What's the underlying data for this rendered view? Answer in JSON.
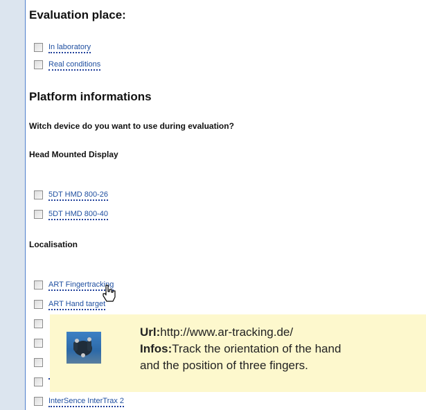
{
  "sections": {
    "evaluation_title": "Evaluation place:",
    "platform_title": "Platform informations",
    "device_question": "Witch device do you want to use during evaluation?",
    "hmd_title": "Head Mounted Display",
    "localisation_title": "Localisation"
  },
  "evaluation_options": [
    {
      "label": "In laboratory",
      "checked": false
    },
    {
      "label": "Real conditions",
      "checked": false
    }
  ],
  "hmd_options": [
    {
      "label": "5DT HMD 800-26",
      "checked": false
    },
    {
      "label": "5DT HMD 800-40",
      "checked": false
    }
  ],
  "localisation_options": [
    {
      "label": "ART Fingertracking",
      "checked": false
    },
    {
      "label": "ART Hand target",
      "checked": false
    },
    {
      "label": "",
      "checked": false
    },
    {
      "label": "",
      "checked": false
    },
    {
      "label": "",
      "checked": false
    },
    {
      "label": "",
      "checked": false
    },
    {
      "label": "InterSence InterTrax 2",
      "checked": false
    }
  ],
  "tooltip": {
    "url_label": "Url:",
    "url_value": "http://www.ar-tracking.de/",
    "infos_label": "Infos:",
    "infos_line1": "Track the orientation of the hand",
    "infos_line2": "and the position of three fingers."
  }
}
